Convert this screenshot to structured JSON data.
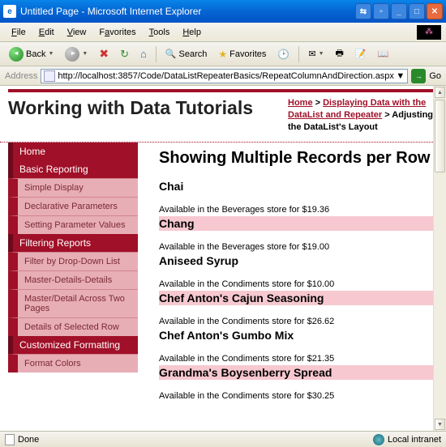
{
  "window": {
    "title": "Untitled Page - Microsoft Internet Explorer"
  },
  "menu": {
    "file": "File",
    "edit": "Edit",
    "view": "View",
    "favorites": "Favorites",
    "tools": "Tools",
    "help": "Help"
  },
  "toolbar": {
    "back": "Back",
    "search": "Search",
    "favorites": "Favorites"
  },
  "address": {
    "label": "Address",
    "url": "http://localhost:3857/Code/DataListRepeaterBasics/RepeatColumnAndDirection.aspx",
    "go": "Go"
  },
  "page": {
    "title": "Working with Data Tutorials",
    "crumbs": {
      "home": "Home",
      "sep": " > ",
      "section": "Displaying Data with the DataList and Repeater",
      "current": "Adjusting the DataList's Layout"
    },
    "heading": "Showing Multiple Records per Row"
  },
  "sidebar": {
    "home": "Home",
    "basic": "Basic Reporting",
    "basic_items": [
      "Simple Display",
      "Declarative Parameters",
      "Setting Parameter Values"
    ],
    "filtering": "Filtering Reports",
    "filtering_items": [
      "Filter by Drop-Down List",
      "Master-Details-Details",
      "Master/Detail Across Two Pages",
      "Details of Selected Row"
    ],
    "custom": "Customized Formatting",
    "custom_items": [
      "Format Colors"
    ]
  },
  "products": [
    {
      "name": "Chai",
      "avail": "Available in the Beverages store for $19.36",
      "hl": false
    },
    {
      "name": "Chang",
      "avail": "Available in the Beverages store for $19.00",
      "hl": true
    },
    {
      "name": "Aniseed Syrup",
      "avail": "Available in the Condiments store for $10.00",
      "hl": false
    },
    {
      "name": "Chef Anton's Cajun Seasoning",
      "avail": "Available in the Condiments store for $26.62",
      "hl": true
    },
    {
      "name": "Chef Anton's Gumbo Mix",
      "avail": "Available in the Condiments store for $21.35",
      "hl": false
    },
    {
      "name": "Grandma's Boysenberry Spread",
      "avail": "Available in the Condiments store for $30.25",
      "hl": true
    }
  ],
  "status": {
    "done": "Done",
    "zone": "Local intranet"
  }
}
